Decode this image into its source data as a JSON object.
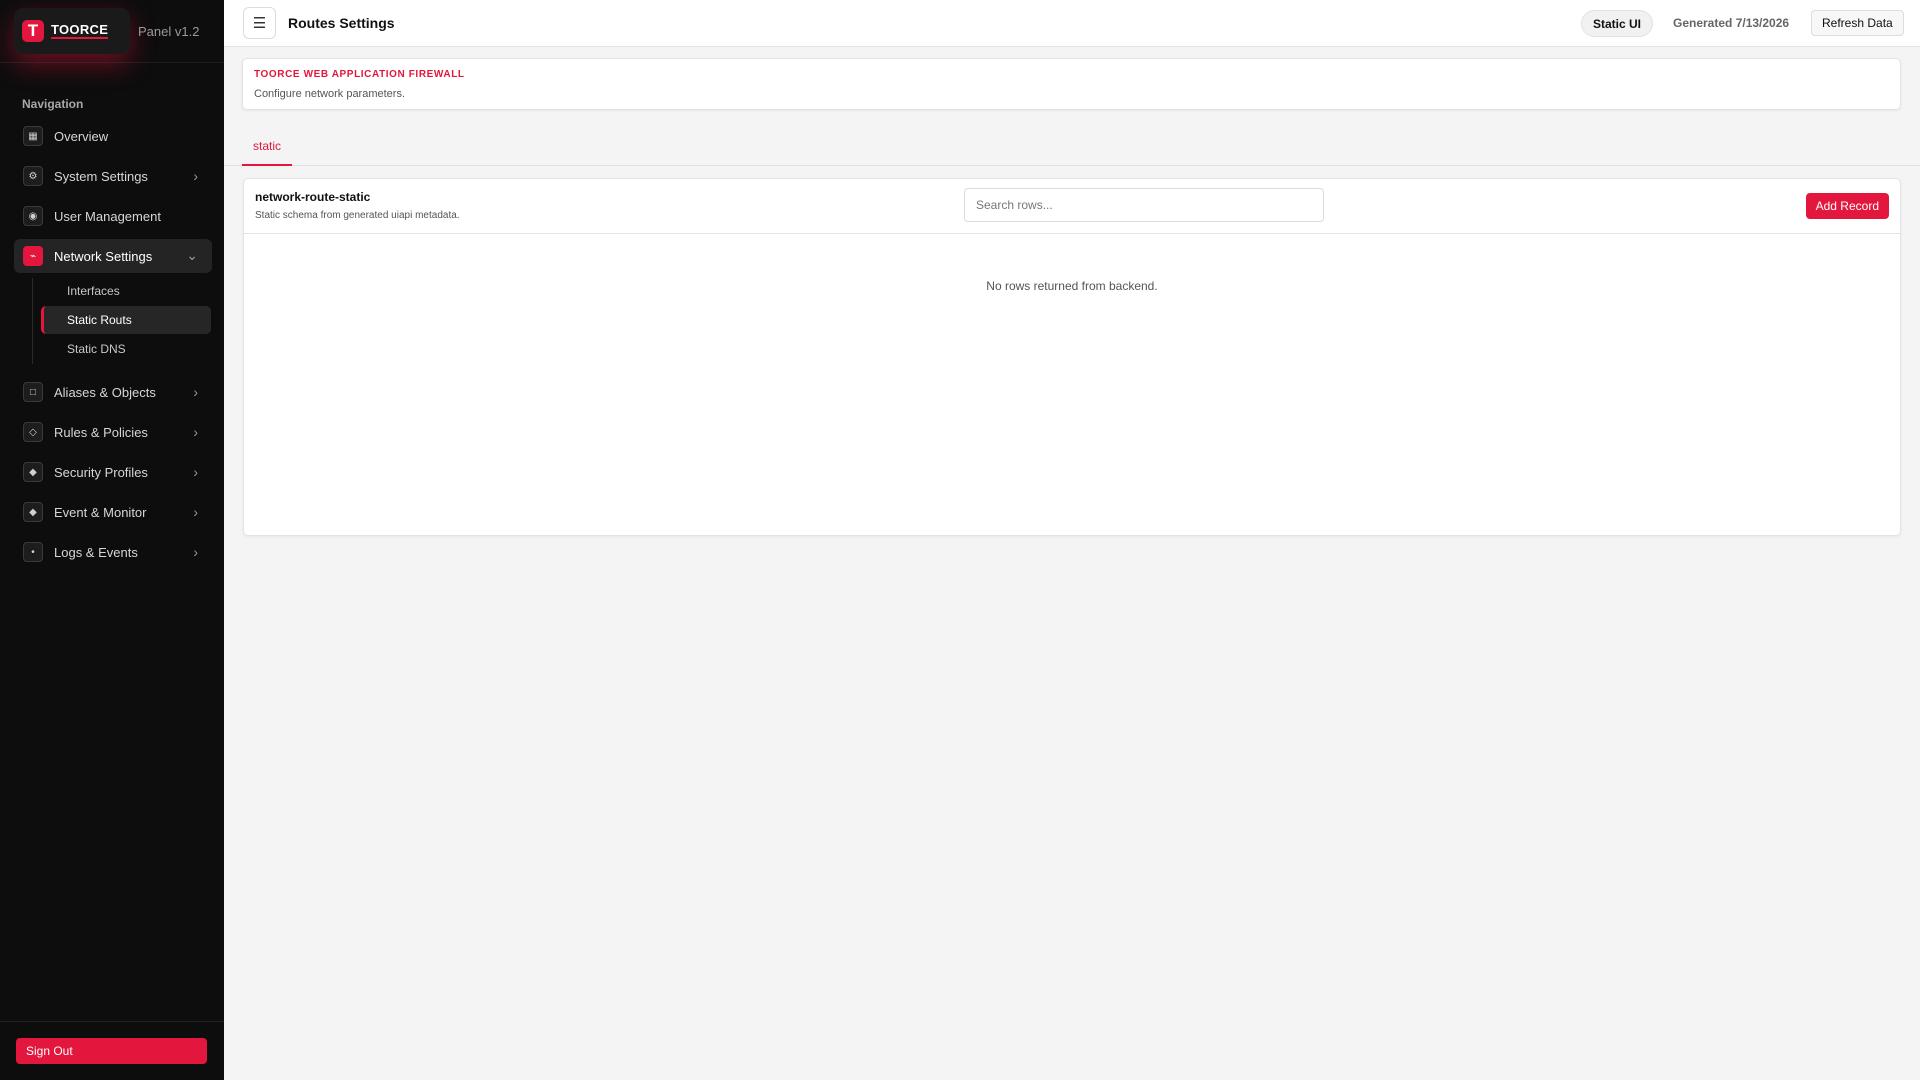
{
  "brand": {
    "logo_letter": "T",
    "name": "TOORCE",
    "version": "Panel v1.2"
  },
  "sidebar": {
    "heading": "Navigation",
    "items": [
      {
        "label": "Overview",
        "icon": "grid-icon",
        "glyph": "▦",
        "chevron": ""
      },
      {
        "label": "System Settings",
        "icon": "gear-icon",
        "glyph": "⚙",
        "chevron": "›"
      },
      {
        "label": "User Management",
        "icon": "user-icon",
        "glyph": "◉",
        "chevron": ""
      },
      {
        "label": "Network Settings",
        "icon": "network-icon",
        "glyph": "⌁",
        "chevron": "⌄"
      },
      {
        "label": "Aliases & Objects",
        "icon": "square-icon",
        "glyph": "□",
        "chevron": "›"
      },
      {
        "label": "Rules & Policies",
        "icon": "diamond-outline-icon",
        "glyph": "◇",
        "chevron": "›"
      },
      {
        "label": "Security Profiles",
        "icon": "diamond-icon",
        "glyph": "◆",
        "chevron": "›"
      },
      {
        "label": "Event & Monitor",
        "icon": "diamond-icon",
        "glyph": "◆",
        "chevron": "›"
      },
      {
        "label": "Logs & Events",
        "icon": "dot-icon",
        "glyph": "•",
        "chevron": "›"
      }
    ],
    "subitems": [
      {
        "label": "Interfaces"
      },
      {
        "label": "Static Routs"
      },
      {
        "label": "Static DNS"
      }
    ],
    "signout_label": "Sign Out"
  },
  "header": {
    "menu_glyph": "☰",
    "title": "Routes Settings",
    "pill_label": "Static UI",
    "generated_label": "Generated 7/13/2026",
    "refresh_label": "Refresh Data"
  },
  "info": {
    "title": "TOORCE WEB APPLICATION FIREWALL",
    "subtitle": "Configure network parameters."
  },
  "tabs": [
    {
      "label": "static"
    }
  ],
  "table": {
    "title": "network-route-static",
    "subtitle": "Static schema from generated uiapi metadata.",
    "search_placeholder": "Search rows...",
    "add_label": "Add Record",
    "empty_message": "No rows returned from backend."
  },
  "colors": {
    "accent": "#e3173d",
    "sidebar_bg": "#0d0d0d",
    "page_bg": "#f4f4f4"
  }
}
